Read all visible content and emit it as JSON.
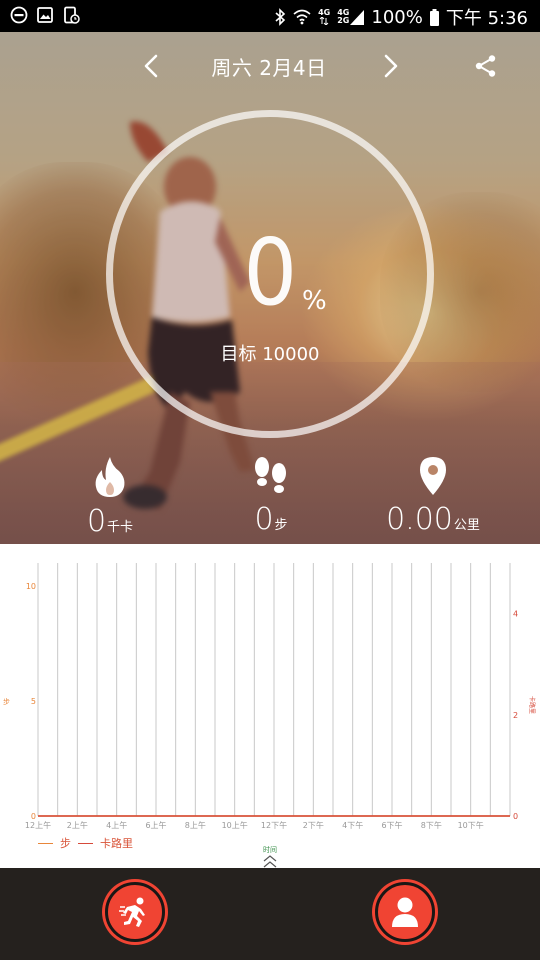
{
  "status_bar": {
    "battery": "100%",
    "time": "下午 5:36",
    "net_top": "4G",
    "net_a": "4G",
    "net_b": "2G",
    "icons": [
      "dnd-icon",
      "gallery-icon",
      "screenshot-icon",
      "bluetooth-icon",
      "wifi-icon",
      "signal-icon",
      "battery-icon"
    ]
  },
  "header": {
    "date": "周六  2月4日",
    "prev_icon": "chevron-left-icon",
    "next_icon": "chevron-right-icon",
    "share_icon": "share-icon"
  },
  "progress": {
    "percent": "0",
    "percent_sign": "%",
    "goal": "目标 10000"
  },
  "stats": {
    "calories": {
      "value": "0",
      "unit": "千卡",
      "icon": "flame-icon"
    },
    "steps": {
      "value": "0",
      "unit": "步",
      "icon": "footprints-icon"
    },
    "distance": {
      "value": "0.00",
      "unit": "公里",
      "icon": "location-pin-icon"
    }
  },
  "chart_data": {
    "type": "line",
    "x_tick_labels": [
      "12上午",
      "2上午",
      "4上午",
      "6上午",
      "8上午",
      "10上午",
      "12下午",
      "2下午",
      "4下午",
      "6下午",
      "8下午",
      "10下午"
    ],
    "x_categories": 24,
    "left_axis": {
      "label": "步",
      "ticks": [
        "0",
        "5",
        "10"
      ],
      "ylim": [
        0,
        11
      ]
    },
    "right_axis": {
      "label": "卡路里",
      "ticks": [
        "0",
        "2",
        "4"
      ],
      "ylim": [
        0,
        5
      ]
    },
    "xlabel": "时间",
    "series": [
      {
        "name": "步",
        "color": "#e8863a",
        "values": [
          0,
          0,
          0,
          0,
          0,
          0,
          0,
          0,
          0,
          0,
          0,
          0,
          0,
          0,
          0,
          0,
          0,
          0,
          0,
          0,
          0,
          0,
          0,
          0
        ]
      },
      {
        "name": "卡路里",
        "color": "#d64a3a",
        "values": [
          0,
          0,
          0,
          0,
          0,
          0,
          0,
          0,
          0,
          0,
          0,
          0,
          0,
          0,
          0,
          0,
          0,
          0,
          0,
          0,
          0,
          0,
          0,
          0
        ]
      }
    ],
    "legend_position": "bottom-left",
    "grid": "vertical"
  },
  "chart": {
    "legend_steps": "步",
    "legend_calories": "卡路里",
    "time_label": "时间",
    "expand_icon": "chevron-up-icon"
  },
  "bottom_bar": {
    "run_icon": "runner-icon",
    "profile_icon": "person-icon"
  }
}
